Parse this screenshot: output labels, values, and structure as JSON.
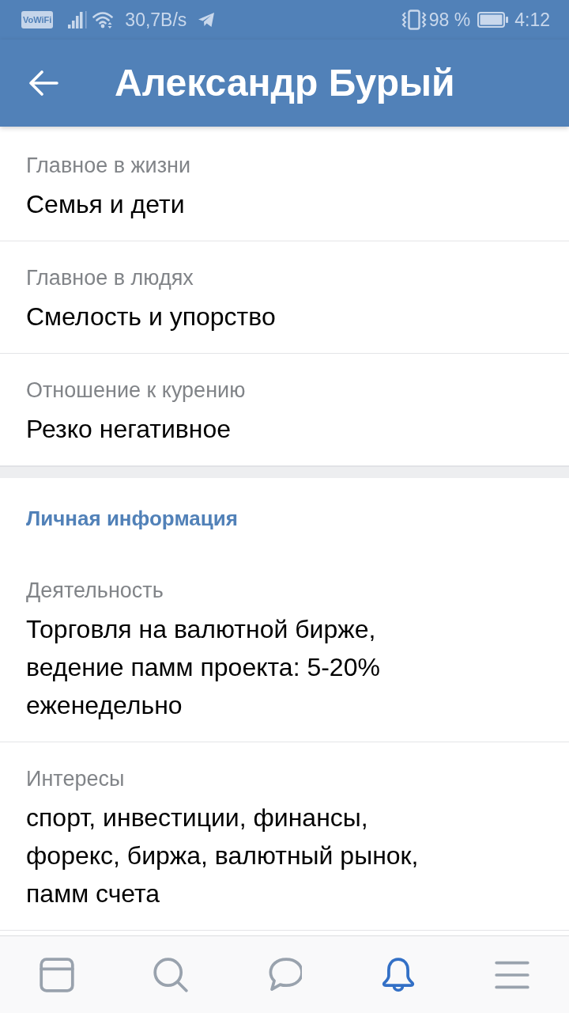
{
  "status_bar": {
    "network_badge": "VoWiFi",
    "speed": "30,7B/s",
    "battery": "98 %",
    "time": "4:12"
  },
  "app_bar": {
    "title": "Александр Бурый"
  },
  "sections": [
    {
      "items": [
        {
          "label": "Главное в жизни",
          "value": "Семья и дети"
        },
        {
          "label": "Главное в людях",
          "value": "Смелость и упорство"
        },
        {
          "label": "Отношение к курению",
          "value": "Резко негативное"
        }
      ]
    },
    {
      "title": "Личная информация",
      "items": [
        {
          "label": "Деятельность",
          "value": "Торговля на валютной бирже,\nведение памм проекта: 5-20%\nеженедельно"
        },
        {
          "label": "Интересы",
          "value": "спорт, инвестиции, финансы,\nфорекс, биржа, валютный рынок,\nпамм счета"
        }
      ]
    }
  ],
  "bottom_nav": [
    {
      "kind": "window",
      "selected": false
    },
    {
      "kind": "search",
      "selected": false
    },
    {
      "kind": "chat",
      "selected": false
    },
    {
      "kind": "bell",
      "selected": true
    },
    {
      "kind": "menu",
      "selected": false
    }
  ]
}
